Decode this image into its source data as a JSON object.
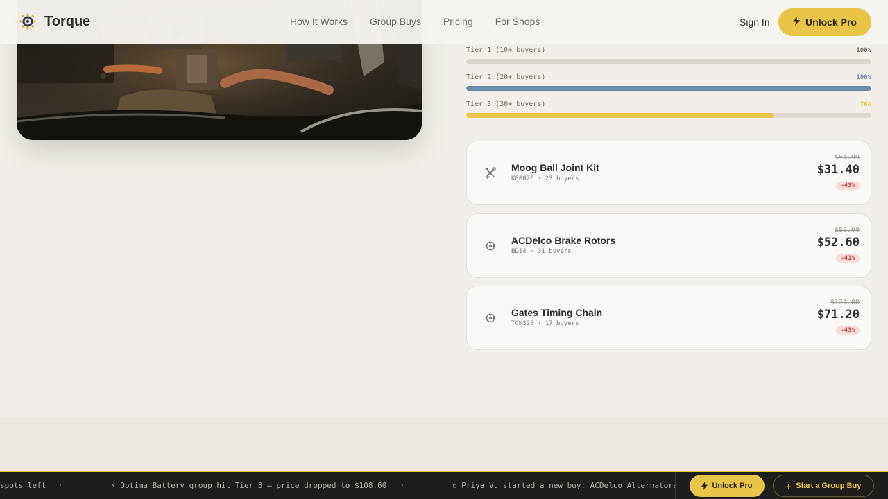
{
  "header": {
    "brand": "Torque",
    "nav": [
      "How It Works",
      "Group Buys",
      "Pricing",
      "For Shops"
    ],
    "sign_in": "Sign In",
    "unlock_pro": "Unlock Pro"
  },
  "hero": {
    "image": "engine-bay-photo"
  },
  "tiers": [
    {
      "label": "Tier 1 (10+ buyers)",
      "pct_label": "100%",
      "progress": 100,
      "color": "#d9d5ce",
      "label_color": "#6f6b65"
    },
    {
      "label": "Tier 2 (20+ buyers)",
      "pct_label": "100%",
      "progress": 100,
      "color": "#6b8aa3",
      "label_color": "#6b8aa3"
    },
    {
      "label": "Tier 3 (30+ buyers)",
      "pct_label": "76%",
      "progress": 76,
      "color": "#e8c547",
      "label_color": "#e8c547"
    }
  ],
  "deals": [
    {
      "icon": "wrench-screwdriver-icon",
      "name": "Moog Ball Joint Kit",
      "meta": "K80026 · 23 buyers",
      "old_price": "$54.99",
      "price": "$31.40",
      "discount": "-43%"
    },
    {
      "icon": "brake-rotor-icon",
      "name": "ACDelco Brake Rotors",
      "meta": "BD14 · 31 buyers",
      "old_price": "$89.00",
      "price": "$52.60",
      "discount": "-41%"
    },
    {
      "icon": "gear-icon",
      "name": "Gates Timing Chain",
      "meta": "TCK328 · 17 buyers",
      "old_price": "$124.00",
      "price": "$71.20",
      "discount": "-43%"
    }
  ],
  "ticker": {
    "items": [
      "spots left",
      "⚡ Optima Battery group hit Tier 3 — price dropped to $108.60",
      "◽ Priya V. started a new buy: ACDelco Alternators"
    ],
    "separator": "·"
  },
  "bottom_bar": {
    "unlock_pro": "Unlock Pro",
    "start_group_buy": "Start a Group Buy"
  },
  "colors": {
    "accent": "#e8c547",
    "steel": "#6b8aa3",
    "discount": "#b8463c"
  }
}
